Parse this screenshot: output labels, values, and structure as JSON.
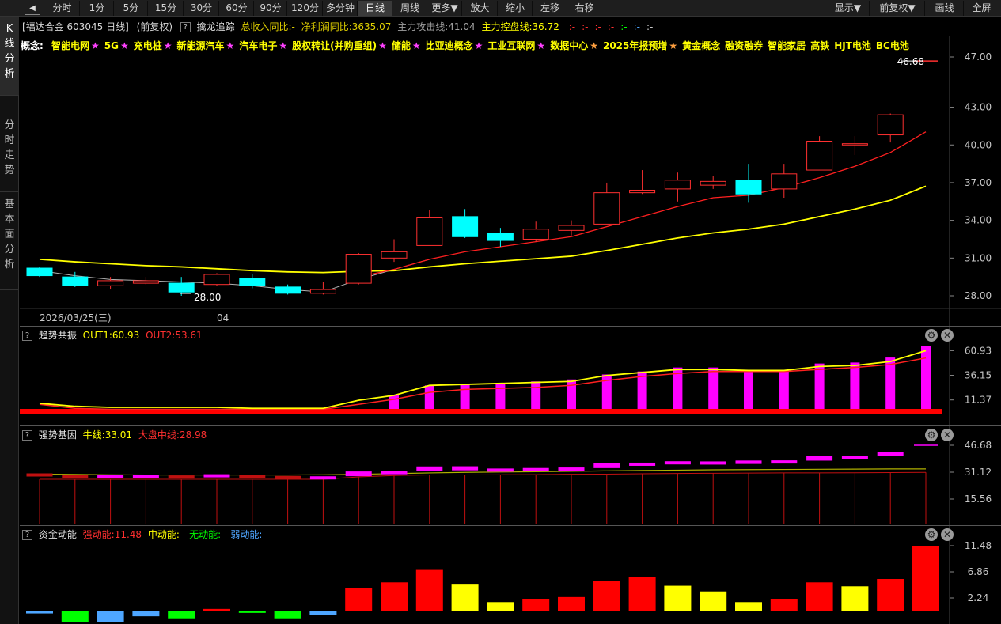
{
  "toolbar": {
    "back_icon": "back-arrow-icon",
    "left_items": [
      {
        "label": "分时",
        "active": false
      },
      {
        "label": "1分",
        "active": false
      },
      {
        "label": "5分",
        "active": false
      },
      {
        "label": "15分",
        "active": false
      },
      {
        "label": "30分",
        "active": false
      },
      {
        "label": "60分",
        "active": false
      },
      {
        "label": "90分",
        "active": false
      },
      {
        "label": "120分",
        "active": false
      },
      {
        "label": "多分钟",
        "active": false
      },
      {
        "label": "日线",
        "active": true
      },
      {
        "label": "周线",
        "active": false
      },
      {
        "label": "更多▼",
        "active": false
      },
      {
        "label": "放大",
        "active": false
      },
      {
        "label": "缩小",
        "active": false
      },
      {
        "label": "左移",
        "active": false
      },
      {
        "label": "右移",
        "active": false
      }
    ],
    "right_items": [
      {
        "label": "显示▼"
      },
      {
        "label": "前复权▼"
      },
      {
        "label": "画线"
      },
      {
        "label": "全屏"
      }
    ]
  },
  "sidebar": {
    "tabs": [
      {
        "label": "K线分析",
        "active": true
      },
      {
        "label": "分时走势",
        "active": false
      },
      {
        "label": "基本面分析",
        "active": false
      }
    ]
  },
  "stock": {
    "title": "[福达合金 603045 日线]",
    "adjust": "(前复权)",
    "indicator_name": "擒龙追踪",
    "revenue": "总收入同比:-",
    "net_profit": "净利润同比:3635.07",
    "attack_line": "主力攻击线:41.04",
    "control_line": "主力控盘线:36.72",
    "tail_marks": [
      ":-",
      ":-",
      ":-",
      ":-",
      ":-",
      ":-",
      ":-"
    ]
  },
  "concepts": {
    "prefix": "概念:",
    "items": [
      {
        "label": "智能电网",
        "star": "★"
      },
      {
        "label": "5G",
        "star": "★"
      },
      {
        "label": "充电桩",
        "star": "★"
      },
      {
        "label": "新能源汽车",
        "star": "★"
      },
      {
        "label": "汽车电子",
        "star": "★"
      },
      {
        "label": "股权转让(并购重组)",
        "star": "★"
      },
      {
        "label": "储能",
        "star": "★"
      },
      {
        "label": "比亚迪概念",
        "star": "★"
      },
      {
        "label": "工业互联网",
        "star": "★"
      },
      {
        "label": "数据中心",
        "star": "★"
      },
      {
        "label": "2025年报预增",
        "star": "★"
      },
      {
        "label": "黄金概念",
        "star": ""
      },
      {
        "label": "融资融券",
        "star": ""
      },
      {
        "label": "智能家居",
        "star": ""
      },
      {
        "label": "高铁",
        "star": ""
      },
      {
        "label": "HJT电池",
        "star": ""
      },
      {
        "label": "BC电池",
        "star": ""
      }
    ]
  },
  "colors": {
    "up": "#ff3030",
    "down": "#00ffff",
    "ma_yellow": "#ffff00",
    "ma_red": "#ff2020",
    "magenta": "#ff00ff",
    "green_bar": "#00ff00",
    "blue_bar": "#4ea6ff",
    "gray_line": "#b0b0b0",
    "concept_yellow": "#ffff00",
    "star_magenta": "#ff40ff",
    "star_orange": "#ffa040"
  },
  "price_axis": {
    "labels": [
      "47.00",
      "43.00",
      "40.00",
      "37.00",
      "34.00",
      "31.00",
      "28.00"
    ],
    "high_mark": "46.68",
    "low_mark": "28.00"
  },
  "date_axis": {
    "start_label": "2026/03/25(三)",
    "month_label": "04"
  },
  "chart_data": {
    "type": "candlestick",
    "ylim": [
      27.4,
      48.2
    ],
    "candles": [
      {
        "o": 30.2,
        "c": 29.6,
        "h": 30.3,
        "l": 29.5
      },
      {
        "o": 29.5,
        "c": 28.8,
        "h": 29.9,
        "l": 28.7
      },
      {
        "o": 28.8,
        "c": 29.2,
        "h": 29.5,
        "l": 28.5
      },
      {
        "o": 29.0,
        "c": 29.2,
        "h": 29.5,
        "l": 28.9
      },
      {
        "o": 29.0,
        "c": 28.3,
        "h": 29.5,
        "l": 28.0
      },
      {
        "o": 28.9,
        "c": 29.7,
        "h": 29.8,
        "l": 28.8
      },
      {
        "o": 29.4,
        "c": 28.8,
        "h": 29.7,
        "l": 28.6
      },
      {
        "o": 28.7,
        "c": 28.2,
        "h": 28.9,
        "l": 28.1
      },
      {
        "o": 28.2,
        "c": 28.5,
        "h": 29.1,
        "l": 28.1
      },
      {
        "o": 29.0,
        "c": 31.3,
        "h": 31.4,
        "l": 28.9
      },
      {
        "o": 31.0,
        "c": 31.5,
        "h": 32.5,
        "l": 30.7
      },
      {
        "o": 32.0,
        "c": 34.2,
        "h": 34.8,
        "l": 32.0
      },
      {
        "o": 34.3,
        "c": 32.7,
        "h": 34.9,
        "l": 32.6
      },
      {
        "o": 33.0,
        "c": 32.4,
        "h": 33.4,
        "l": 31.9
      },
      {
        "o": 32.5,
        "c": 33.3,
        "h": 33.9,
        "l": 32.3
      },
      {
        "o": 33.2,
        "c": 33.6,
        "h": 34.0,
        "l": 32.8
      },
      {
        "o": 33.7,
        "c": 36.2,
        "h": 37.0,
        "l": 33.7
      },
      {
        "o": 36.2,
        "c": 36.4,
        "h": 38.0,
        "l": 36.1
      },
      {
        "o": 36.5,
        "c": 37.2,
        "h": 37.8,
        "l": 35.5
      },
      {
        "o": 36.8,
        "c": 37.1,
        "h": 37.5,
        "l": 36.5
      },
      {
        "o": 37.2,
        "c": 36.1,
        "h": 38.5,
        "l": 35.4
      },
      {
        "o": 36.5,
        "c": 37.7,
        "h": 38.5,
        "l": 35.8
      },
      {
        "o": 38.0,
        "c": 40.3,
        "h": 40.7,
        "l": 38.0
      },
      {
        "o": 40.0,
        "c": 40.1,
        "h": 40.7,
        "l": 39.2
      },
      {
        "o": 40.8,
        "c": 42.4,
        "h": 42.5,
        "l": 40.2
      },
      {
        "o": 46.68,
        "c": 46.68,
        "h": 46.68,
        "l": 46.68
      }
    ],
    "ma_yellow": [
      30.9,
      30.7,
      30.55,
      30.4,
      30.3,
      30.15,
      30.0,
      29.9,
      29.85,
      29.95,
      30.0,
      30.3,
      30.55,
      30.75,
      30.95,
      31.15,
      31.6,
      32.1,
      32.6,
      33.0,
      33.3,
      33.7,
      34.3,
      34.9,
      35.6,
      36.72
    ],
    "ma_red": [
      null,
      null,
      null,
      null,
      null,
      null,
      null,
      null,
      null,
      29.5,
      30.1,
      30.9,
      31.5,
      31.9,
      32.3,
      32.7,
      33.5,
      34.3,
      35.1,
      35.8,
      36.0,
      36.6,
      37.4,
      38.3,
      39.4,
      41.04
    ],
    "ma_gray": [
      30.0,
      29.6,
      29.3,
      29.2,
      29.1,
      29.0,
      28.8,
      28.5,
      28.3,
      29.3,
      30.1,
      30.9
    ]
  },
  "panel_trend": {
    "help": "?",
    "name": "趋势共振",
    "out1": "OUT1:60.93",
    "out2": "OUT2:53.61",
    "axis_labels": [
      "60.93",
      "36.15",
      "11.37"
    ],
    "ylim": [
      0,
      66
    ],
    "baseline": 0,
    "out1_values": [
      8,
      5,
      4,
      4,
      4,
      4,
      3,
      3,
      3,
      11,
      16,
      26,
      27,
      28,
      29,
      30,
      36,
      39,
      42,
      42,
      41,
      41,
      45,
      46,
      50,
      60.93
    ],
    "out2_values": [
      7,
      3,
      2,
      2,
      2,
      2,
      2,
      2,
      2,
      7,
      12,
      19,
      22,
      23,
      24,
      26,
      31,
      35,
      38,
      40,
      40,
      40,
      42,
      44,
      47,
      53.61
    ],
    "bar_values": [
      0,
      0,
      0,
      0,
      0,
      0,
      0,
      0,
      0,
      0,
      16,
      26,
      27,
      28,
      30,
      32,
      37,
      40,
      44,
      44,
      41,
      41,
      48,
      49,
      54,
      66
    ]
  },
  "panel_gene": {
    "help": "?",
    "name": "强势基因",
    "bull": "牛线:33.01",
    "market": "大盘中线:28.98",
    "axis_labels": [
      "46.68",
      "31.12",
      "15.56"
    ],
    "ylim": [
      0,
      50
    ],
    "red_line": [
      28.5,
      28.5,
      28.5,
      28.5,
      28.5,
      28.5,
      28.5,
      28.5,
      28.5,
      29.0,
      29.3,
      29.6,
      29.8,
      30.0,
      30.2,
      30.4,
      30.6,
      30.8,
      31.0,
      31.1,
      31.2,
      31.3,
      31.3,
      31.4,
      31.4,
      31.5
    ],
    "yellow_line": [
      30.0,
      29.8,
      29.6,
      29.5,
      29.5,
      29.5,
      29.5,
      29.5,
      29.6,
      29.9,
      30.3,
      30.7,
      31.0,
      31.2,
      31.4,
      31.6,
      31.9,
      32.1,
      32.3,
      32.5,
      32.6,
      32.7,
      32.8,
      32.9,
      33.0,
      33.01
    ],
    "candles": [
      {
        "o": 30.2,
        "c": 29.6
      },
      {
        "o": 29.5,
        "c": 28.8
      },
      {
        "o": 28.8,
        "c": 29.2
      },
      {
        "o": 29.0,
        "c": 29.2
      },
      {
        "o": 29.0,
        "c": 28.3
      },
      {
        "o": 28.9,
        "c": 29.7
      },
      {
        "o": 29.4,
        "c": 28.8
      },
      {
        "o": 28.7,
        "c": 28.2
      },
      {
        "o": 28.2,
        "c": 28.5
      },
      {
        "o": 29.0,
        "c": 31.3
      },
      {
        "o": 31.0,
        "c": 31.5
      },
      {
        "o": 32.0,
        "c": 34.2
      },
      {
        "o": 32.4,
        "c": 34.3
      },
      {
        "o": 32.4,
        "c": 33.0
      },
      {
        "o": 32.5,
        "c": 33.3
      },
      {
        "o": 33.2,
        "c": 33.6
      },
      {
        "o": 33.7,
        "c": 36.2
      },
      {
        "o": 36.2,
        "c": 36.4
      },
      {
        "o": 36.5,
        "c": 37.2
      },
      {
        "o": 36.8,
        "c": 37.1
      },
      {
        "o": 36.1,
        "c": 37.6
      },
      {
        "o": 36.5,
        "c": 37.7
      },
      {
        "o": 38.0,
        "c": 40.3
      },
      {
        "o": 40.0,
        "c": 40.1
      },
      {
        "o": 40.8,
        "c": 42.4
      },
      {
        "o": 46.68,
        "c": 46.68
      }
    ],
    "stems": [
      27.0,
      27.0,
      27.0,
      27.0,
      27.0,
      27.0,
      27.0,
      27.0,
      27.0,
      28.4,
      29.2,
      29.5,
      29.5,
      29.6,
      29.7,
      29.9,
      30.0,
      30.2,
      30.4,
      30.5,
      30.6,
      30.7,
      30.7,
      30.8,
      30.9,
      31.0
    ]
  },
  "panel_fund": {
    "help": "?",
    "name": "资金动能",
    "strong": "强动能:11.48",
    "medium": "中动能:-",
    "none": "无动能:-",
    "weak": "弱动能:-",
    "axis_labels": [
      "11.48",
      "6.86",
      "2.24"
    ],
    "ylim": [
      -2.2,
      11.48
    ],
    "bars": [
      {
        "v": -0.5,
        "c": "blue"
      },
      {
        "v": -2.0,
        "c": "green"
      },
      {
        "v": -2.0,
        "c": "blue"
      },
      {
        "v": -1.0,
        "c": "blue"
      },
      {
        "v": -1.5,
        "c": "green"
      },
      {
        "v": 0.3,
        "c": "red"
      },
      {
        "v": -0.4,
        "c": "green"
      },
      {
        "v": -1.5,
        "c": "green"
      },
      {
        "v": -0.7,
        "c": "blue"
      },
      {
        "v": 4.0,
        "c": "red"
      },
      {
        "v": 5.0,
        "c": "red"
      },
      {
        "v": 7.2,
        "c": "red"
      },
      {
        "v": 4.6,
        "c": "yellow"
      },
      {
        "v": 1.5,
        "c": "yellow"
      },
      {
        "v": 2.0,
        "c": "red"
      },
      {
        "v": 2.4,
        "c": "red"
      },
      {
        "v": 5.2,
        "c": "red"
      },
      {
        "v": 6.0,
        "c": "red"
      },
      {
        "v": 4.4,
        "c": "yellow"
      },
      {
        "v": 3.4,
        "c": "yellow"
      },
      {
        "v": 1.5,
        "c": "yellow"
      },
      {
        "v": 2.1,
        "c": "red"
      },
      {
        "v": 5.0,
        "c": "red"
      },
      {
        "v": 4.3,
        "c": "yellow"
      },
      {
        "v": 5.6,
        "c": "red"
      },
      {
        "v": 11.48,
        "c": "red"
      }
    ]
  }
}
